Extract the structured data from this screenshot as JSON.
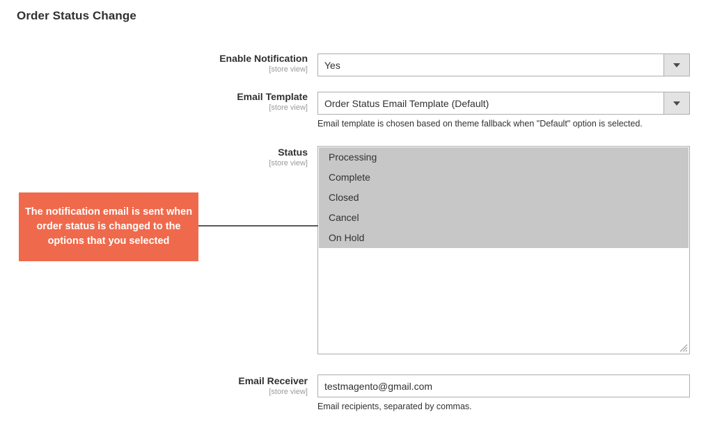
{
  "page": {
    "title": "Order Status Change"
  },
  "scope_note": "[store view]",
  "fields": {
    "enable_notification": {
      "label": "Enable Notification",
      "scope": "[store view]",
      "value": "Yes",
      "control": "select",
      "icon": "chevron-down-icon"
    },
    "email_template": {
      "label": "Email Template",
      "scope": "[store view]",
      "value": "Order Status Email Template (Default)",
      "control": "select",
      "icon": "chevron-down-icon",
      "note": "Email template is chosen based on theme fallback when \"Default\" option is selected."
    },
    "status": {
      "label": "Status",
      "scope": "[store view]",
      "control": "multiselect",
      "options": [
        {
          "label": "Processing",
          "selected": true
        },
        {
          "label": "Complete",
          "selected": true
        },
        {
          "label": "Closed",
          "selected": true
        },
        {
          "label": "Cancel",
          "selected": true
        },
        {
          "label": "On Hold",
          "selected": true
        }
      ]
    },
    "email_receiver": {
      "label": "Email Receiver",
      "scope": "[store view]",
      "value": "testmagento@gmail.com",
      "control": "text",
      "note": "Email recipients, separated by commas."
    }
  },
  "annotation": {
    "text": "The notification email is sent when order status is changed to the options that you selected",
    "background_color": "#ef6a4c",
    "text_color": "#ffffff",
    "line_color": "#595959"
  },
  "colors": {
    "accent": "#ef6a4c",
    "border": "#adadad",
    "selected_option": "#c7c7c7",
    "button_face": "#e3e3e3",
    "text": "#303030",
    "scope_text": "#9a9a9a"
  }
}
